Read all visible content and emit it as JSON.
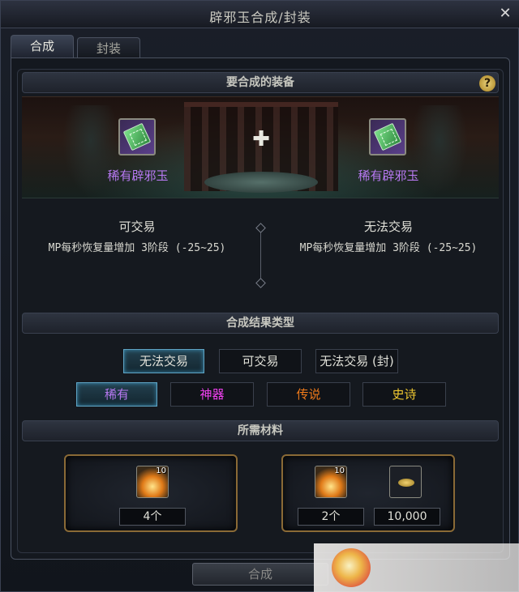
{
  "window": {
    "title": "辟邪玉合成/封装",
    "close_label": "✕"
  },
  "tabs": [
    {
      "label": "合成",
      "active": true
    },
    {
      "label": "封装",
      "active": false
    }
  ],
  "section_equipment": {
    "header": "要合成的装备",
    "help_label": "?"
  },
  "items": {
    "left": {
      "name": "稀有辟邪玉",
      "trade_status": "可交易",
      "stat": "MP每秒恢复量增加 3阶段 (-25~25)"
    },
    "right": {
      "name": "稀有辟邪玉",
      "trade_status": "无法交易",
      "stat": "MP每秒恢复量增加 3阶段 (-25~25)"
    },
    "combine_icon": "plus-icon"
  },
  "section_result": {
    "header": "合成结果类型",
    "trade_options": [
      "无法交易",
      "可交易",
      "无法交易 (封)"
    ],
    "selected_trade_option": "无法交易",
    "rarity_options": [
      "稀有",
      "神器",
      "传说",
      "史诗"
    ],
    "selected_rarity": "稀有",
    "rarity_colors": {
      "稀有": "#b678f0",
      "神器": "#f040f0",
      "传说": "#f07a1a",
      "史诗": "#f0c830"
    }
  },
  "section_materials": {
    "header": "所需材料",
    "option_a": {
      "icon_badge": "10",
      "quantity": "4个"
    },
    "option_b": {
      "icon_badge": "10",
      "quantity": "2个",
      "gold": "10,000"
    }
  },
  "craft_button": "合成",
  "accent_color": "#5fa4c4"
}
